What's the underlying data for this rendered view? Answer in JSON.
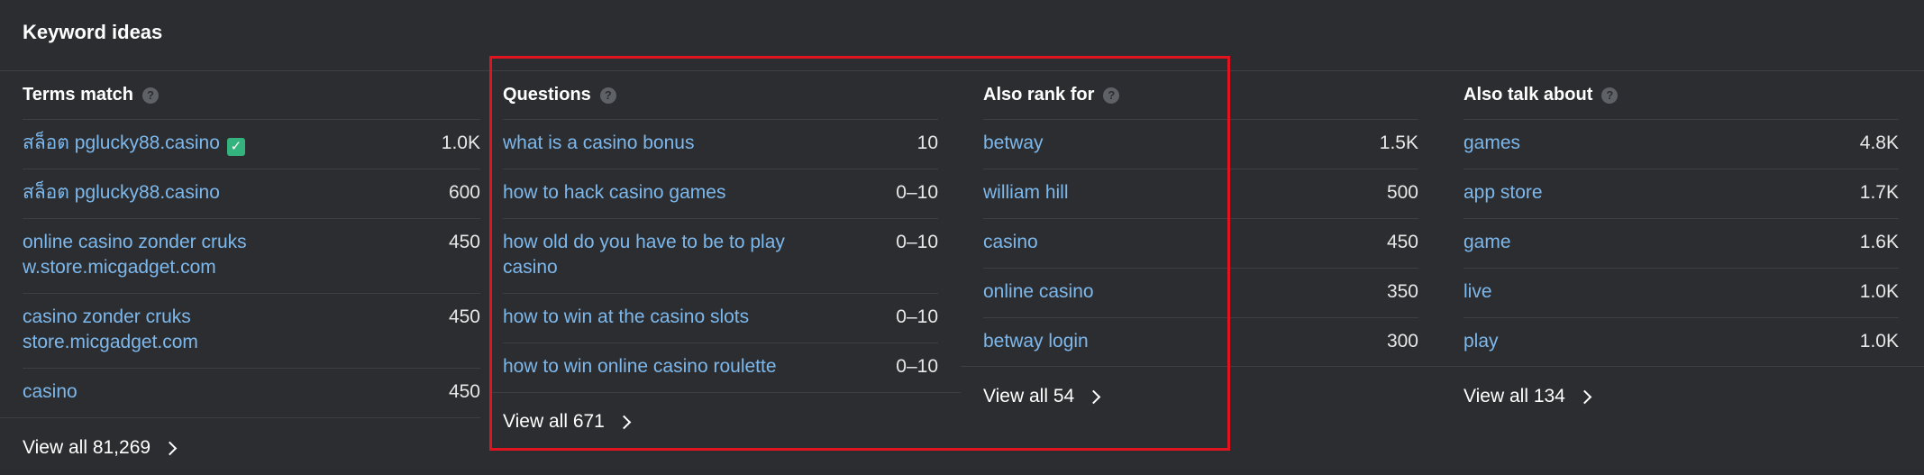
{
  "panel": {
    "title": "Keyword ideas"
  },
  "columns": [
    {
      "title": "Terms match",
      "rows": [
        {
          "keyword": "สล็อต pglucky88.casino",
          "volume": "1.0K",
          "verified": true
        },
        {
          "keyword": "สล็อต pglucky88.casino",
          "volume": "600"
        },
        {
          "keyword": "online casino zonder cruks w.store.micgadget.com",
          "volume": "450"
        },
        {
          "keyword": "casino zonder cruks store.micgadget.com",
          "volume": "450"
        },
        {
          "keyword": "casino",
          "volume": "450"
        }
      ],
      "view_all": "View all 81,269"
    },
    {
      "title": "Questions",
      "rows": [
        {
          "keyword": "what is a casino bonus",
          "volume": "10"
        },
        {
          "keyword": "how to hack casino games",
          "volume": "0–10"
        },
        {
          "keyword": "how old do you have to be to play casino",
          "volume": "0–10"
        },
        {
          "keyword": "how to win at the casino slots",
          "volume": "0–10"
        },
        {
          "keyword": "how to win online casino roulette",
          "volume": "0–10"
        }
      ],
      "view_all": "View all 671"
    },
    {
      "title": "Also rank for",
      "rows": [
        {
          "keyword": "betway",
          "volume": "1.5K"
        },
        {
          "keyword": "william hill",
          "volume": "500"
        },
        {
          "keyword": "casino",
          "volume": "450"
        },
        {
          "keyword": "online casino",
          "volume": "350"
        },
        {
          "keyword": "betway login",
          "volume": "300"
        }
      ],
      "view_all": "View all 54"
    },
    {
      "title": "Also talk about",
      "rows": [
        {
          "keyword": "games",
          "volume": "4.8K"
        },
        {
          "keyword": "app store",
          "volume": "1.7K"
        },
        {
          "keyword": "game",
          "volume": "1.6K"
        },
        {
          "keyword": "live",
          "volume": "1.0K"
        },
        {
          "keyword": "play",
          "volume": "1.0K"
        }
      ],
      "view_all": "View all 134"
    }
  ],
  "icons": {
    "help": "?",
    "check": "✓"
  },
  "colors": {
    "background": "#2c2d30",
    "keyword_link": "#7db8ec",
    "highlight_border": "#e0141e",
    "verified_badge": "#35b37e"
  }
}
